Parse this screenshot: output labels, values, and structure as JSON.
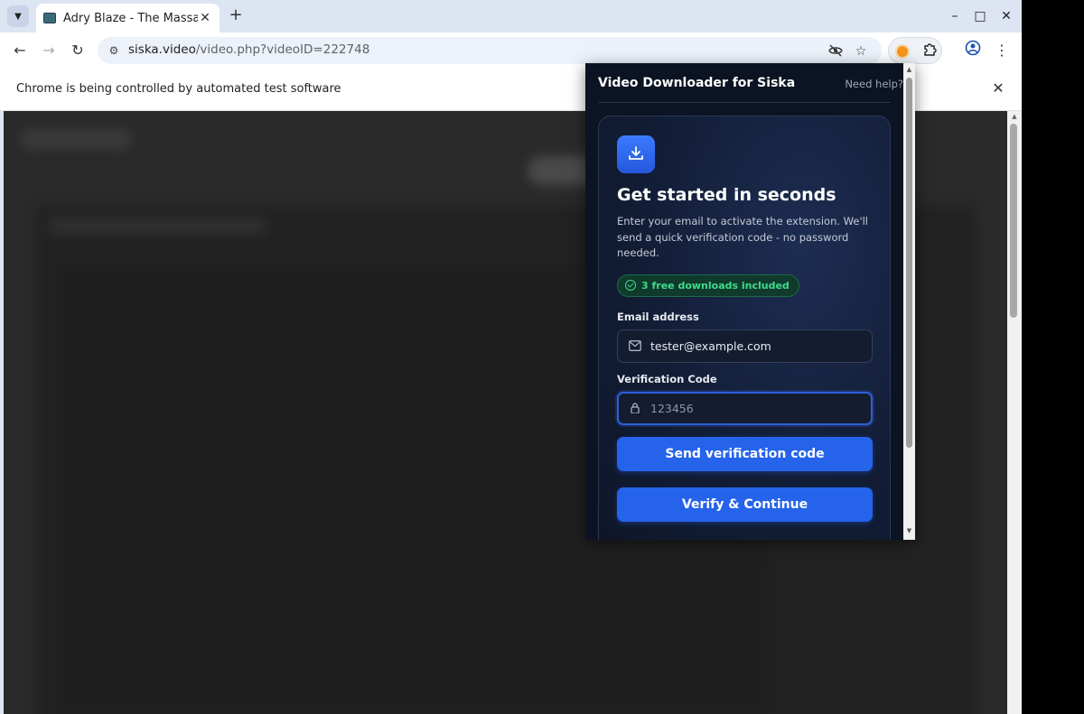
{
  "browser": {
    "tab": {
      "title": "Adry Blaze - The Massage"
    },
    "window_controls": {
      "minimize": "–",
      "maximize": "□",
      "close": "✕"
    },
    "url": {
      "host": "siska.video",
      "path": "/video.php?videoID=222748"
    },
    "infobar": {
      "text": "Chrome is being controlled by automated test software"
    }
  },
  "extension": {
    "title": "Video Downloader for Siska",
    "help_link": "Need help?",
    "heading": "Get started in seconds",
    "description": "Enter your email to activate the extension. We'll send a quick verification code - no password needed.",
    "badge": "3 free downloads included",
    "email": {
      "label": "Email address",
      "value": "tester@example.com"
    },
    "code": {
      "label": "Verification Code",
      "placeholder": "123456"
    },
    "send_button": "Send verification code",
    "verify_button": "Verify & Continue",
    "accent_color": "#2563eb",
    "badge_color": "#3fdc8b"
  }
}
